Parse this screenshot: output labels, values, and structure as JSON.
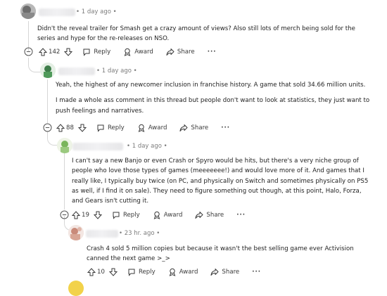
{
  "comments": [
    {
      "time": "1 day ago",
      "paragraphs": [
        "Didn't the reveal trailer for Smash get a crazy amount of views? Also still lots of merch being sold for the series and hype for the re-releases on NSO."
      ],
      "votes": "142"
    },
    {
      "time": "1 day ago",
      "paragraphs": [
        "Yeah, the highest of any newcomer inclusion in franchise history. A game that sold 34.66 million units.",
        "I made a whole ass comment in this thread but people don't want to look at statistics, they just want to push feelings and narratives."
      ],
      "votes": "88"
    },
    {
      "time": "1 day ago",
      "paragraphs": [
        "I can't say a new Banjo or even Crash or Spyro would be hits, but there's a very niche group of people who love those types of games (meeeeeee!) and would love more of it. And games that I really like, I typically buy twice (on PC, and physically on Switch and sometimes physically on PS5 as well, if I find it on sale). They need to figure something out though, at this point, Halo, Forza, and Gears isn't cutting it."
      ],
      "votes": "19"
    },
    {
      "time": "23 hr. ago",
      "paragraphs": [
        "Crash 4 sold 5 million copies but because it wasn't the best selling game ever Activision canned the next game >_>"
      ],
      "votes": "10"
    }
  ],
  "actions": {
    "reply": "Reply",
    "award": "Award",
    "share": "Share",
    "more": "···"
  },
  "colors": {
    "thread_line": "#d6d6d6",
    "text": "#1a1a1b",
    "meta": "#7c7c7c"
  },
  "icons": [
    "collapse-icon",
    "upvote-icon",
    "downvote-icon",
    "reply-icon",
    "award-icon",
    "share-icon",
    "more-icon"
  ]
}
